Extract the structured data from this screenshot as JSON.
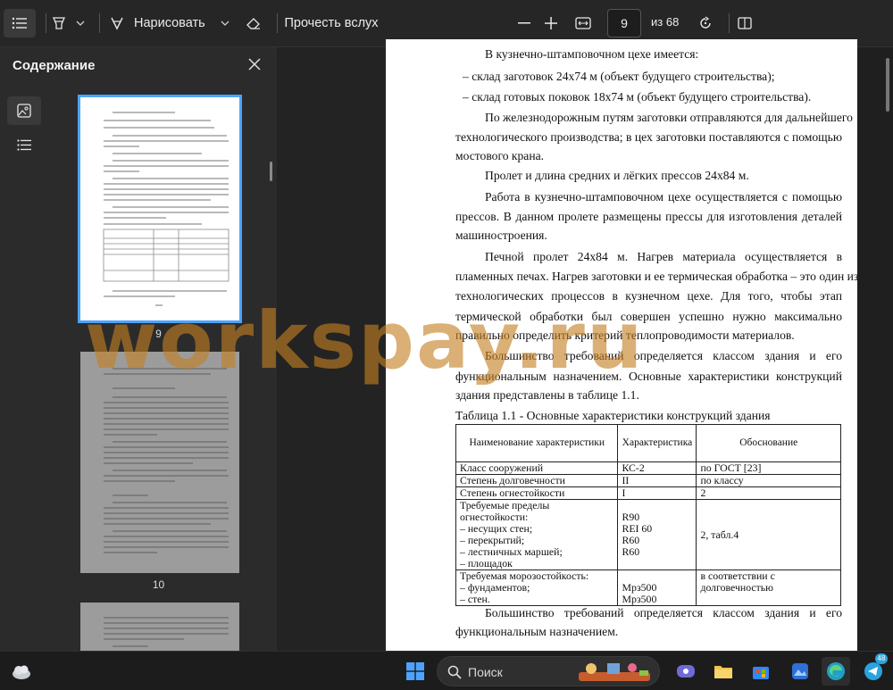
{
  "toolbar": {
    "draw_label": "Нарисовать",
    "read_aloud_label": "Прочесть вслух",
    "page_number": "9",
    "page_total": "из 68"
  },
  "sidebar": {
    "title": "Содержание",
    "thumbnails": [
      {
        "label": "9",
        "selected": true
      },
      {
        "label": "10",
        "selected": false
      }
    ]
  },
  "document": {
    "lines": {
      "l1": "В кузнечно-штамповочном цехе имеется:",
      "l2": "–   склад заготовок 24х74 м (объект будущего строительства);",
      "l3": "–   склад готовых поковок 18х74 м (объект будущего строительства).",
      "l4": "По железнодорожным путям заготовки отправляются для дальнейшего",
      "l5": "технологического производства; в цех заготовки поставляются  с помощью",
      "l6": "мостового крана.",
      "l7": "Пролет и длина средних и лёгких прессов 24х84 м.",
      "l8": "Работа в кузнечно-штамповочном цехе осуществляется  с помощью",
      "l9": "прессов. В данном пролете размещены прессы для изготовления деталей",
      "l10": "машиностроения.",
      "l11": "Печной пролет 24х84 м. Нагрев материала осуществляется в",
      "l12": "пламенных печах. Нагрев заготовки и ее термическая обработка – это один из",
      "l13": "технологических процессов в кузнечном цехе. Для того, чтобы этап",
      "l14": "термической обработки был совершен успешно нужно максимально",
      "l15": "правильно определить критерий теплопроводимости материалов.",
      "l16": "Большинство требований определяется классом здания и его",
      "l17": "функциональным назначением. Основные характеристики конструкций",
      "l18": "здания представлены в таблице 1.1.",
      "table_caption": "Таблица 1.1  - Основные характеристики конструкций здания",
      "l19": "Большинство требований определяется классом здания и его",
      "l20": "функциональным назначением."
    },
    "table": {
      "headers": [
        "Наименование характеристики",
        "Характеристика",
        "Обоснование"
      ],
      "rows": [
        [
          "Класс сооружений",
          "КС-2",
          "по ГОСТ [23]"
        ],
        [
          "Степень долговечности",
          "II",
          "по  классу"
        ],
        [
          "Степень огнестойкости",
          "I",
          "2"
        ]
      ],
      "fire": {
        "name_lines": [
          "Требуемые пределы огнестойкости:",
          "– несущих стен;",
          "– перекрытий;",
          "– лестничных маршей;",
          "– площадок"
        ],
        "values": [
          "R90",
          "REI 60",
          "R60",
          "R60"
        ],
        "basis": "2, табл.4"
      },
      "frost": {
        "name_lines": [
          "Требуемая морозостойкость:",
          "– фундаментов;",
          "– стен."
        ],
        "values": [
          "Мрз500",
          "Мрз500"
        ],
        "basis": "в соответствии с долговечностью"
      }
    }
  },
  "watermark": "workspay.ru",
  "taskbar": {
    "search_label": "Поиск",
    "telegram_badge": "48"
  },
  "colors": {
    "accent": "#4da3ff",
    "watermark": "#c48022",
    "telegram": "#2aa3df"
  }
}
